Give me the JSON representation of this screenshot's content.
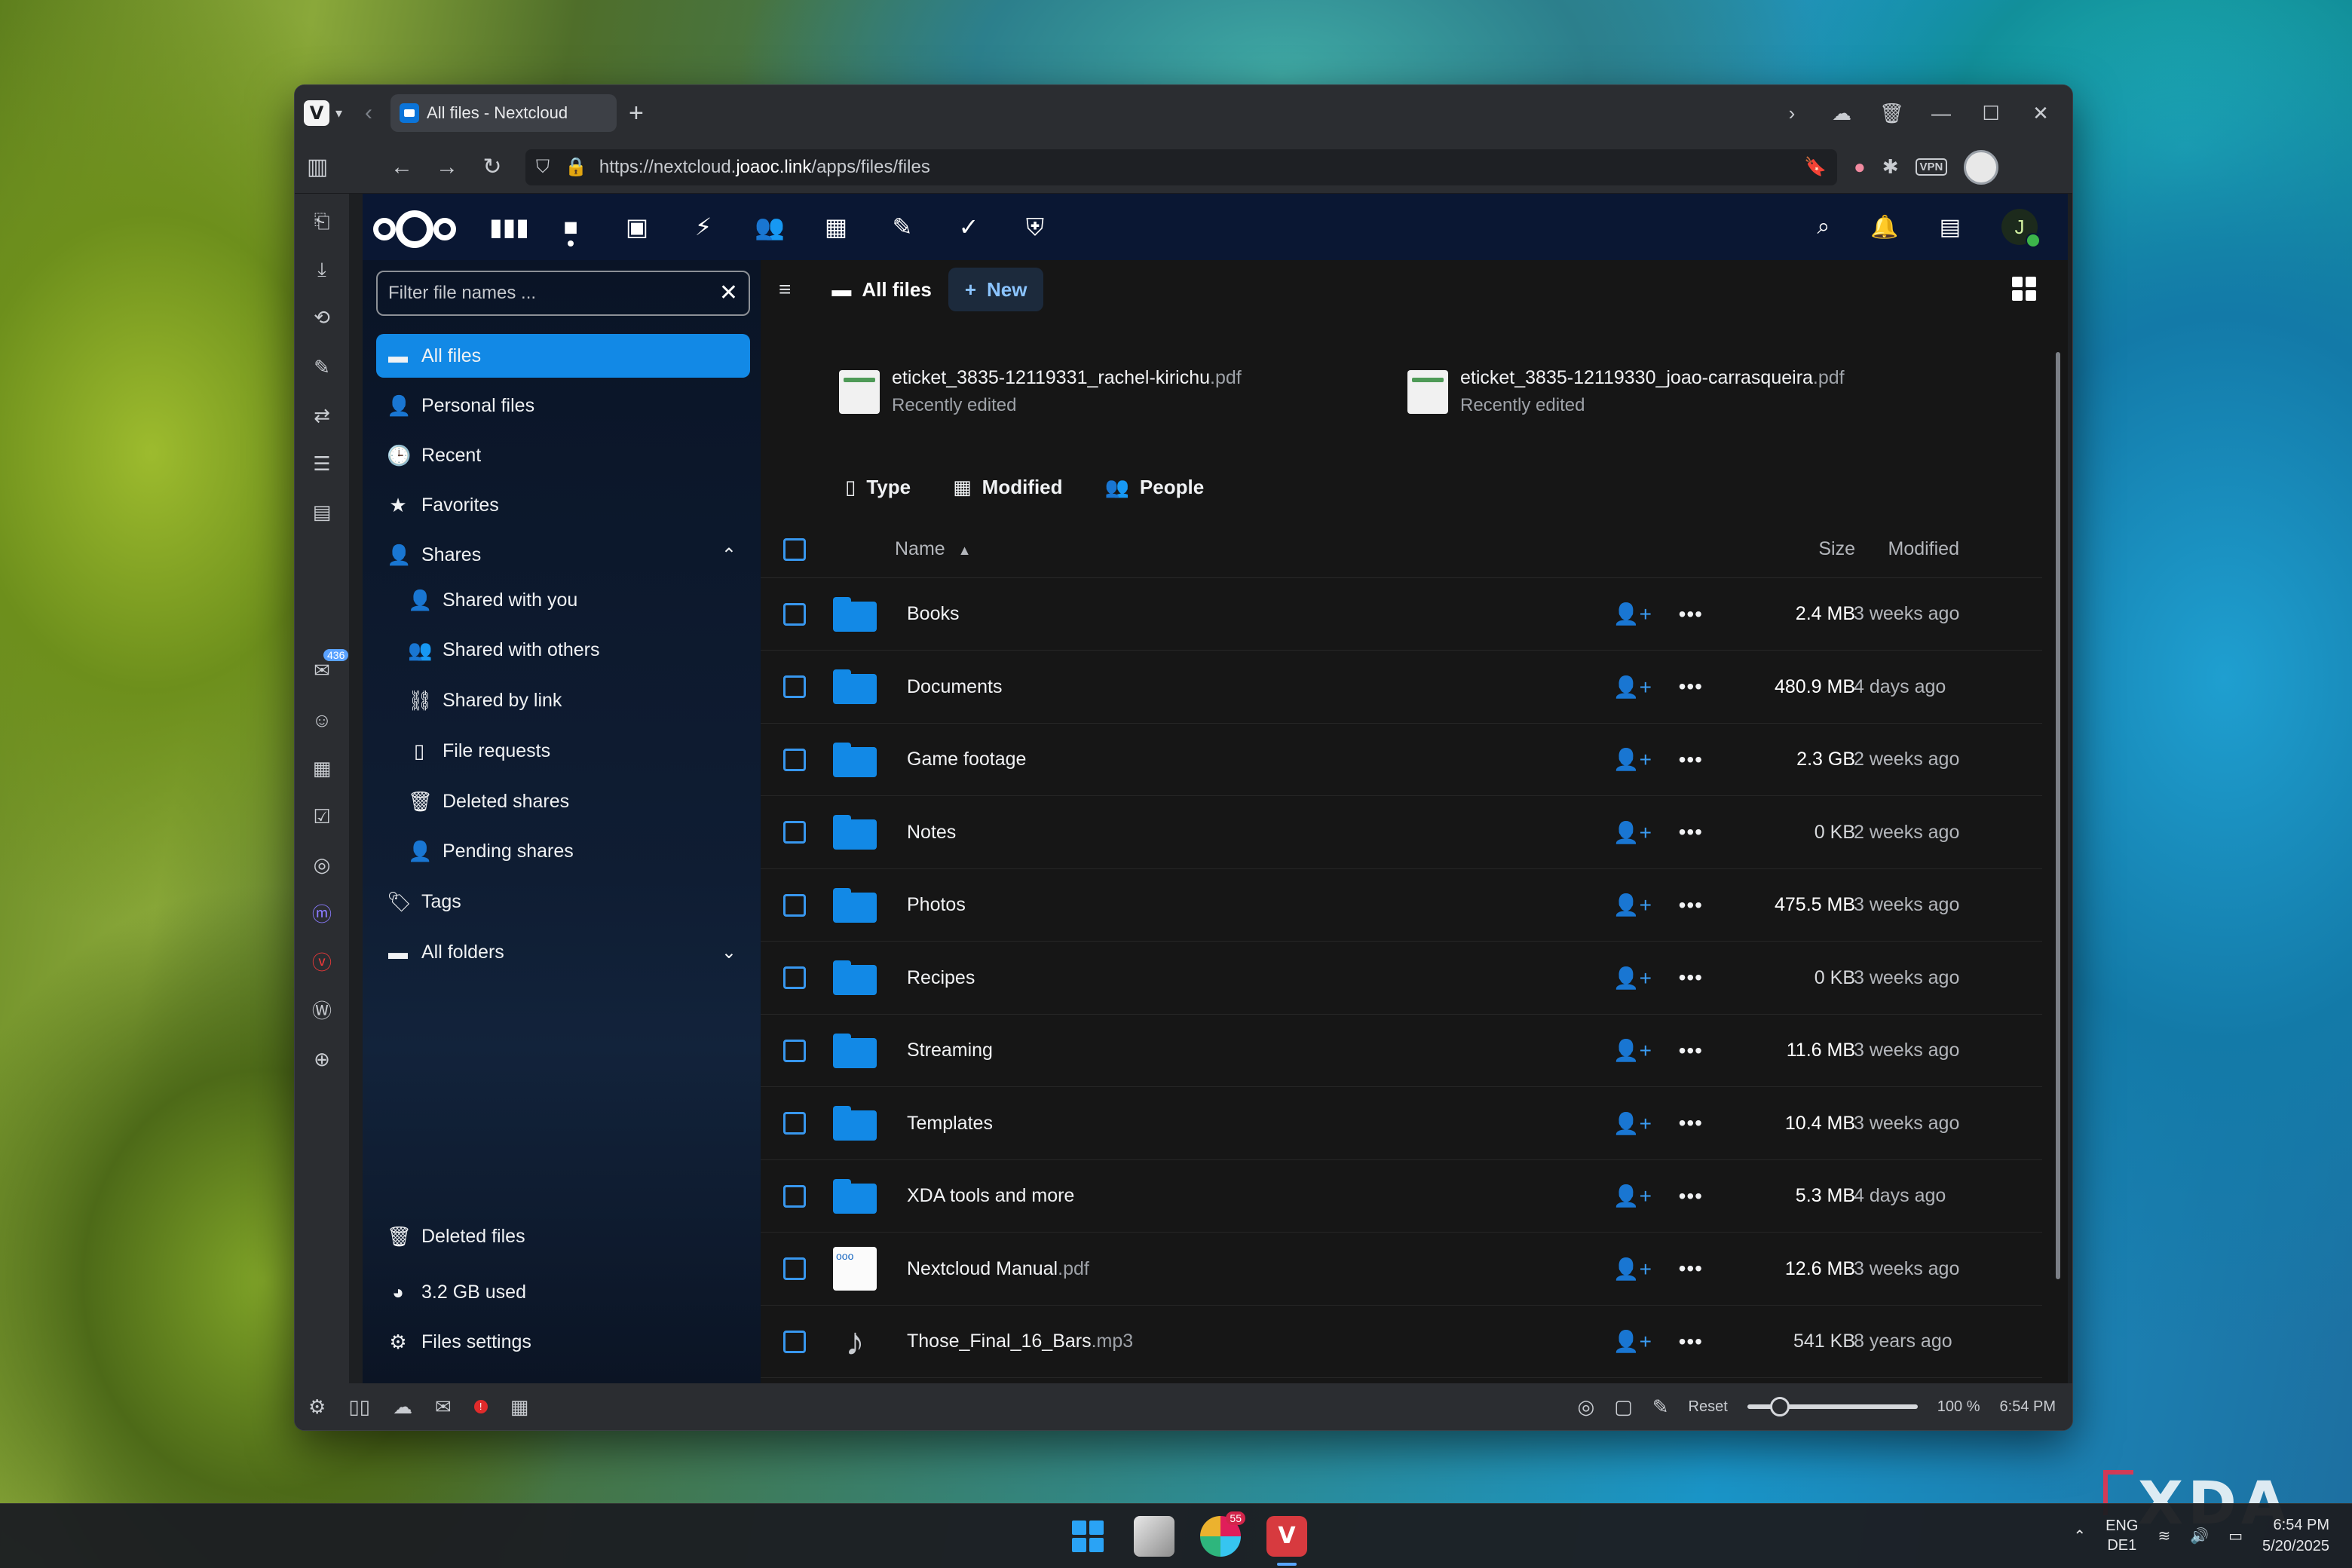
{
  "desktop": {
    "watermark": "XDA"
  },
  "browser": {
    "tab_title": "All files - Nextcloud",
    "url_prefix": "https://nextcloud.",
    "url_host": "joaoc.link",
    "url_path": "/apps/files/files",
    "vpn_label": "VPN",
    "side_panel_badge": "436",
    "status": {
      "reset_label": "Reset",
      "zoom": "100 %",
      "time": "6:54 PM"
    }
  },
  "nextcloud": {
    "user_initial": "J",
    "filter_placeholder": "Filter file names ...",
    "nav": {
      "all_files": "All files",
      "personal_files": "Personal files",
      "recent": "Recent",
      "favorites": "Favorites",
      "shares": "Shares",
      "shared_with_you": "Shared with you",
      "shared_with_others": "Shared with others",
      "shared_by_link": "Shared by link",
      "file_requests": "File requests",
      "deleted_shares": "Deleted shares",
      "pending_shares": "Pending shares",
      "tags": "Tags",
      "all_folders": "All folders",
      "deleted_files": "Deleted files",
      "quota": "3.2 GB used",
      "files_settings": "Files settings"
    },
    "breadcrumb": "All files",
    "new_label": "New",
    "recent_files": [
      {
        "name": "eticket_3835-12119331_rachel-kirichu",
        "ext": ".pdf",
        "sub": "Recently edited"
      },
      {
        "name": "eticket_3835-12119330_joao-carrasqueira",
        "ext": ".pdf",
        "sub": "Recently edited"
      }
    ],
    "filters": {
      "type": "Type",
      "modified": "Modified",
      "people": "People"
    },
    "columns": {
      "name": "Name",
      "size": "Size",
      "modified": "Modified"
    },
    "files": [
      {
        "name": "Books",
        "ext": "",
        "size": "2.4 MB",
        "modified": "3 weeks ago"
      },
      {
        "name": "Documents",
        "ext": "",
        "size": "480.9 MB",
        "modified": "4 days ago"
      },
      {
        "name": "Game footage",
        "ext": "",
        "size": "2.3 GB",
        "modified": "2 weeks ago"
      },
      {
        "name": "Notes",
        "ext": "",
        "size": "0 KB",
        "modified": "2 weeks ago"
      },
      {
        "name": "Photos",
        "ext": "",
        "size": "475.5 MB",
        "modified": "3 weeks ago"
      },
      {
        "name": "Recipes",
        "ext": "",
        "size": "0 KB",
        "modified": "3 weeks ago"
      },
      {
        "name": "Streaming",
        "ext": "",
        "size": "11.6 MB",
        "modified": "3 weeks ago"
      },
      {
        "name": "Templates",
        "ext": "",
        "size": "10.4 MB",
        "modified": "3 weeks ago"
      },
      {
        "name": "XDA tools and more",
        "ext": "",
        "size": "5.3 MB",
        "modified": "4 days ago"
      },
      {
        "name": "Nextcloud Manual",
        "ext": ".pdf",
        "size": "12.6 MB",
        "modified": "3 weeks ago"
      },
      {
        "name": "Those_Final_16_Bars",
        "ext": ".mp3",
        "size": "541 KB",
        "modified": "8 years ago"
      }
    ]
  },
  "taskbar": {
    "slack_badge": "55",
    "lang_top": "ENG",
    "lang_bottom": "DE1",
    "time": "6:54 PM",
    "date": "5/20/2025"
  }
}
